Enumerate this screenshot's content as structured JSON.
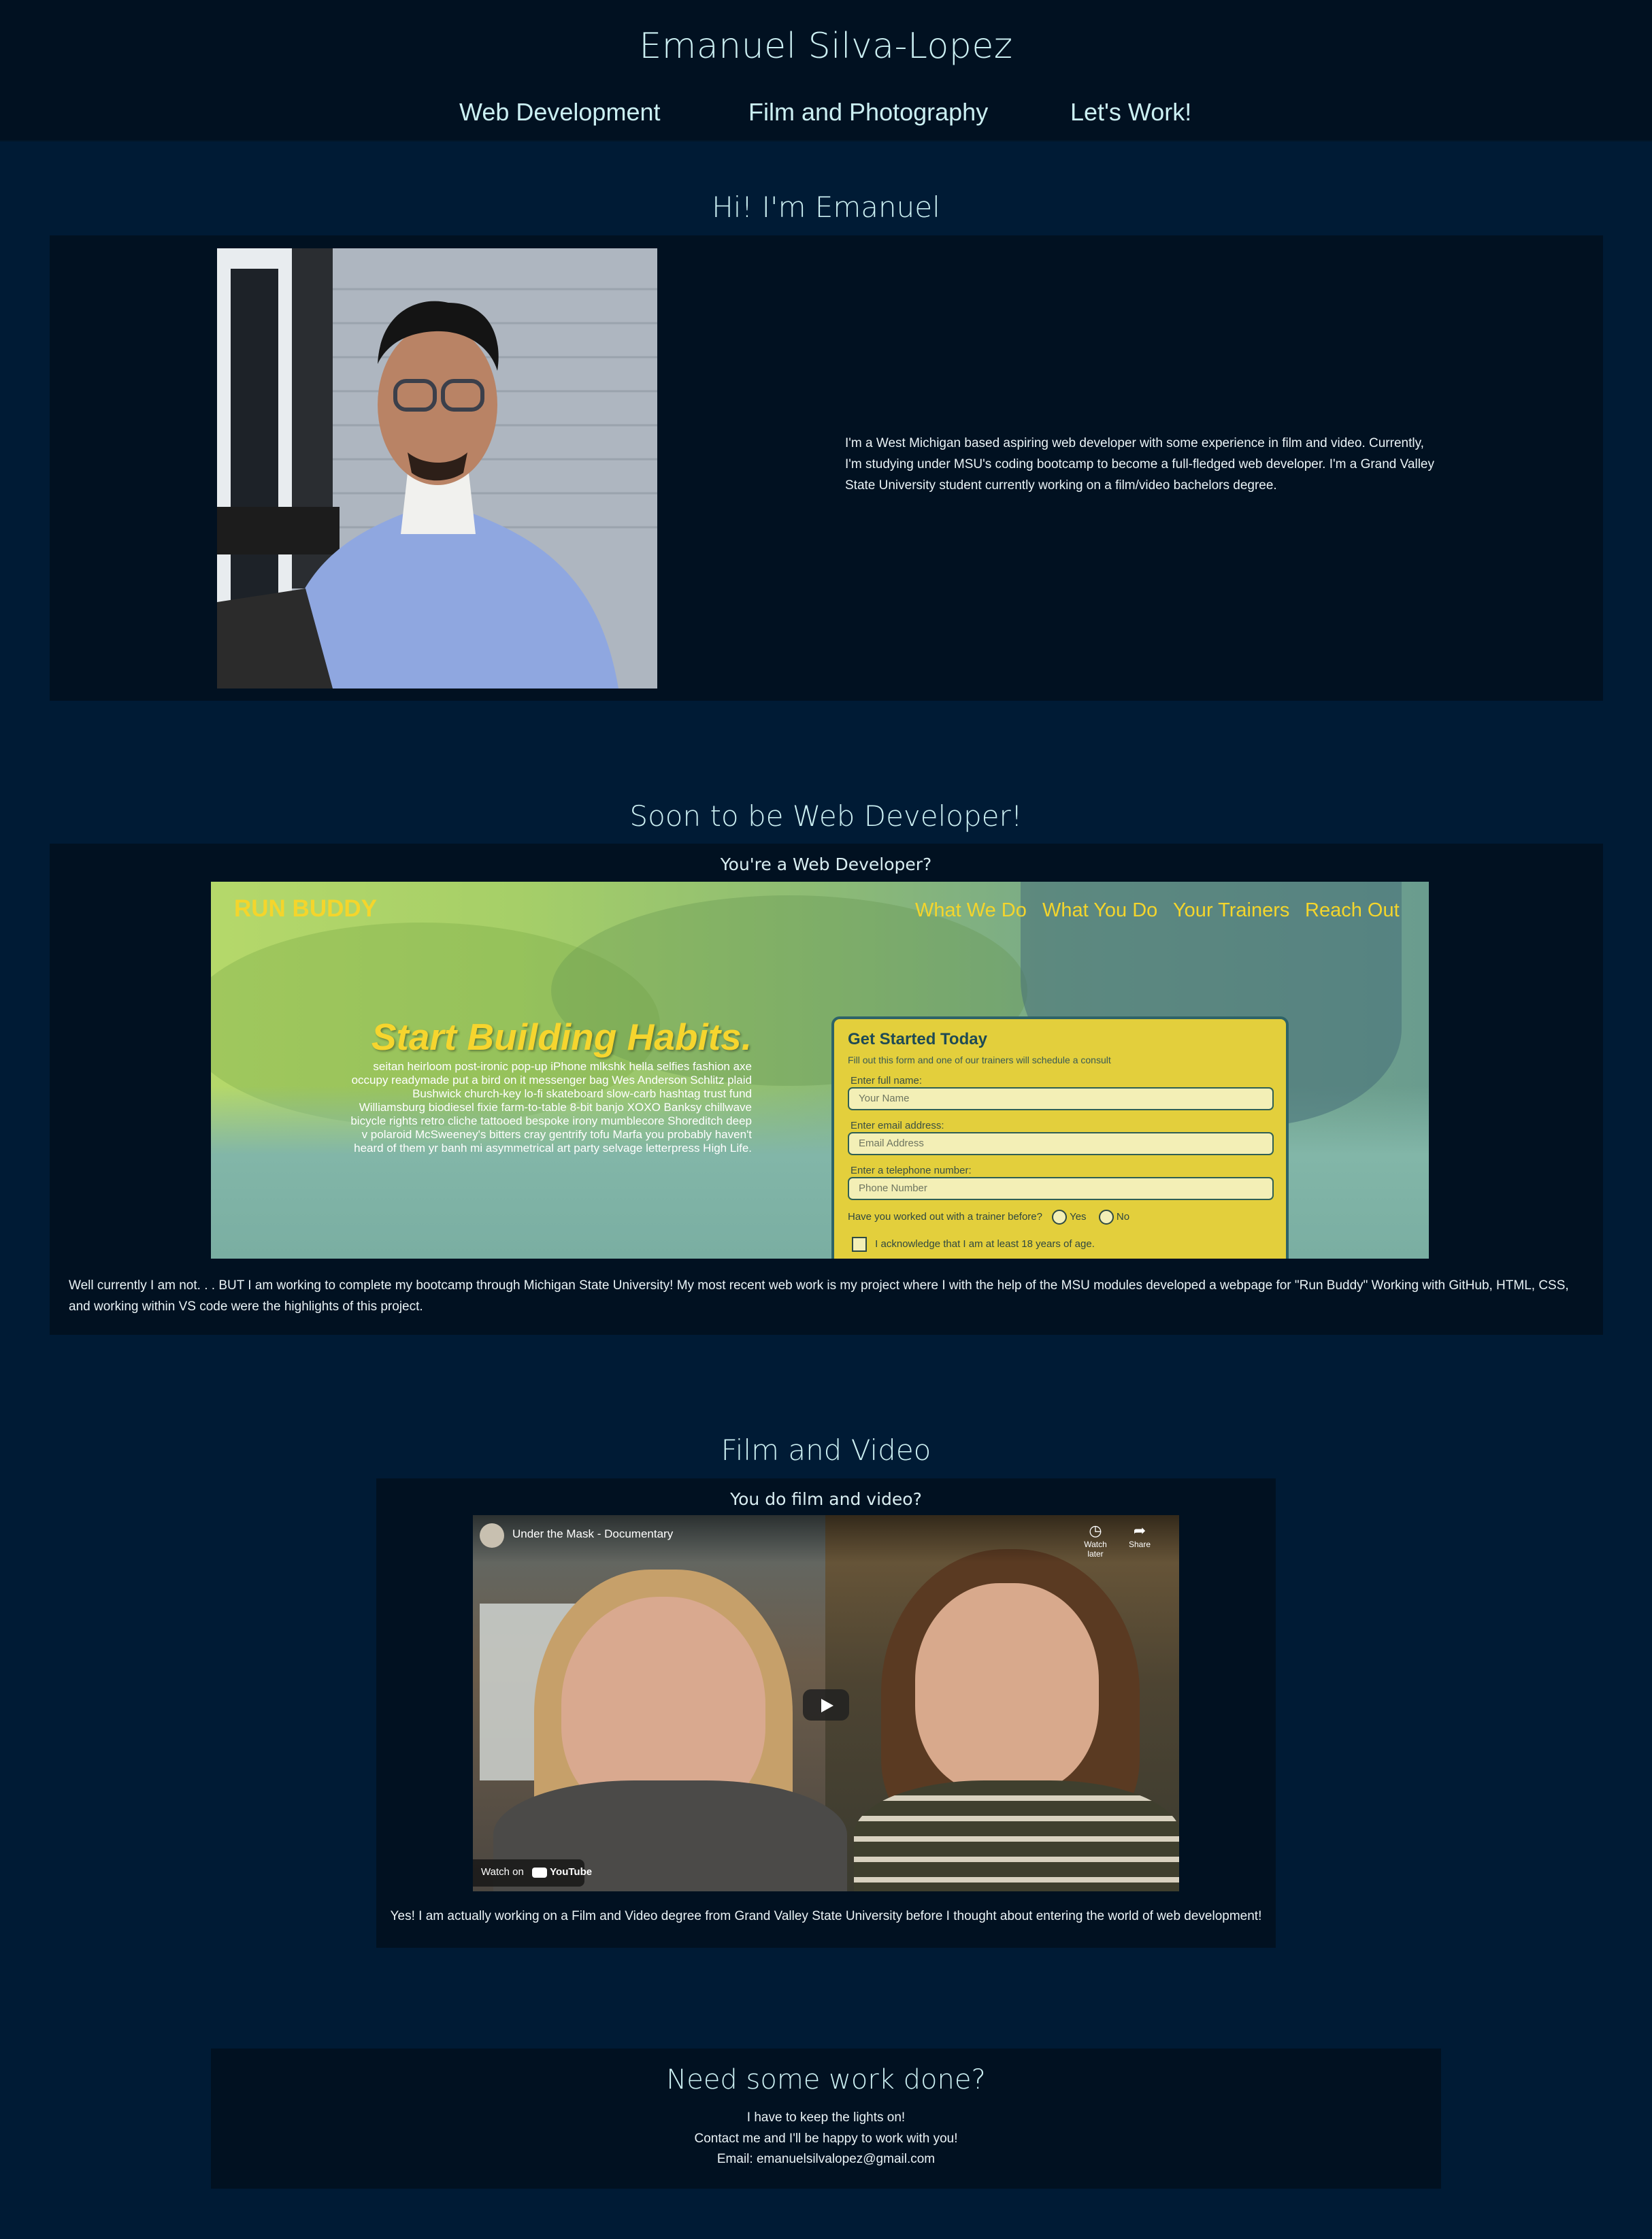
{
  "header": {
    "title": "Emanuel Silva-Lopez",
    "nav": [
      "Web Development",
      "Film and Photography",
      "Let's Work!"
    ]
  },
  "about": {
    "heading": "Hi! I'm Emanuel",
    "photo_alt": "Portrait photo",
    "text": "I'm a West Michigan based aspiring web developer with some experience in film and video. Currently, I'm studying under MSU's coding bootcamp to become a full-fledged web developer. I'm a Grand Valley State University student currently working on a film/video bachelors degree."
  },
  "webdev": {
    "heading": "Soon to be Web Developer!",
    "subtitle": "You're a Web Developer?",
    "screenshot": {
      "logo": "RUN BUDDY",
      "nav": [
        "What We Do",
        "What You Do",
        "Your Trainers",
        "Reach Out"
      ],
      "hero_title": "Start Building Habits.",
      "hero_text": "seitan heirloom post-ironic pop-up iPhone mlkshk hella selfies fashion axe occupy readymade put a bird on it messenger bag Wes Anderson Schlitz plaid Bushwick church-key lo-fi skateboard slow-carb hashtag trust fund Williamsburg biodiesel fixie farm-to-table 8-bit banjo XOXO Banksy chillwave bicycle rights retro cliche tattooed bespoke irony mumblecore Shoreditch deep v polaroid McSweeney's bitters cray gentrify tofu Marfa you probably haven't heard of them yr banh mi asymmetrical art party selvage letterpress High Life.",
      "form": {
        "title": "Get Started Today",
        "subtitle": "Fill out this form and one of our trainers will schedule a consult",
        "name_label": "Enter full name:",
        "name_placeholder": "Your Name",
        "email_label": "Enter email address:",
        "email_placeholder": "Email Address",
        "phone_label": "Enter a telephone number:",
        "phone_placeholder": "Phone Number",
        "question": "Have you worked out with a trainer before?",
        "yes": "Yes",
        "no": "No",
        "ack": "I acknowledge that I am at least 18 years of age."
      }
    },
    "text": "Well currently I am not. . . BUT I am working to complete my bootcamp through Michigan State University! My most recent web work is my project where I with the help of the MSU modules developed a webpage for \"Run Buddy\" Working with GitHub, HTML, CSS, and working within VS code were the highlights of this project."
  },
  "film": {
    "heading": "Film and Video",
    "subtitle": "You do film and video?",
    "video": {
      "title": "Under the Mask - Documentary",
      "watch_later": "Watch later",
      "share": "Share",
      "watch_on": "Watch on",
      "youtube": "YouTube"
    },
    "text": "Yes! I am actually working on a Film and Video degree from Grand Valley State University before I thought about entering the world of web development!"
  },
  "contact": {
    "heading": "Need some work done?",
    "line1": "I have to keep the lights on!",
    "line2": "Contact me and I'll be happy to work with you!",
    "line3": "Email: emanuelsilvalopez@gmail.com"
  },
  "colors": {
    "page_bg": "#001b35",
    "panel_bg": "#011121",
    "heading": "#cbeff2",
    "runbuddy_yellow": "#f4d52c"
  }
}
